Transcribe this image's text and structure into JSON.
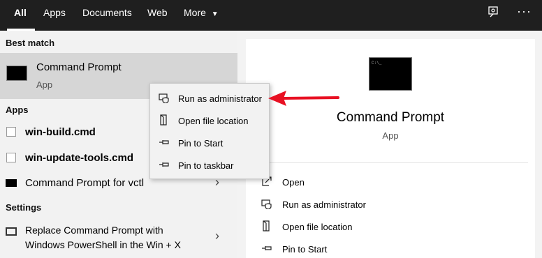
{
  "tabs": [
    {
      "label": "All"
    },
    {
      "label": "Apps"
    },
    {
      "label": "Documents"
    },
    {
      "label": "Web"
    },
    {
      "label": "More"
    }
  ],
  "more_caret": "▼",
  "top_icons": {
    "feedback": "feedback-icon",
    "more": "ellipsis-icon",
    "ellipsis": "···"
  },
  "left": {
    "best_match_header": "Best match",
    "best_match": {
      "title": "Command Prompt",
      "subtitle": "App"
    },
    "apps_header": "Apps",
    "apps": [
      {
        "label": "win-build.cmd"
      },
      {
        "label": "win-update-tools.cmd"
      },
      {
        "label": "Command Prompt for vctl"
      }
    ],
    "settings_header": "Settings",
    "settings_line1": "Replace Command Prompt with",
    "settings_line2": "Windows PowerShell in the Win + X"
  },
  "context_menu": [
    {
      "label": "Run as administrator",
      "icon": "shield-icon"
    },
    {
      "label": "Open file location",
      "icon": "folder-icon"
    },
    {
      "label": "Pin to Start",
      "icon": "pin-icon"
    },
    {
      "label": "Pin to taskbar",
      "icon": "pin-icon"
    }
  ],
  "preview": {
    "title": "Command Prompt",
    "subtitle": "App",
    "actions": [
      {
        "label": "Open",
        "icon": "open-icon"
      },
      {
        "label": "Run as administrator",
        "icon": "shield-icon"
      },
      {
        "label": "Open file location",
        "icon": "folder-icon"
      },
      {
        "label": "Pin to Start",
        "icon": "pin-icon"
      }
    ]
  },
  "colors": {
    "topbar": "#1f1f1f",
    "arrow": "#e81123",
    "selected": "#d6d6d6"
  }
}
